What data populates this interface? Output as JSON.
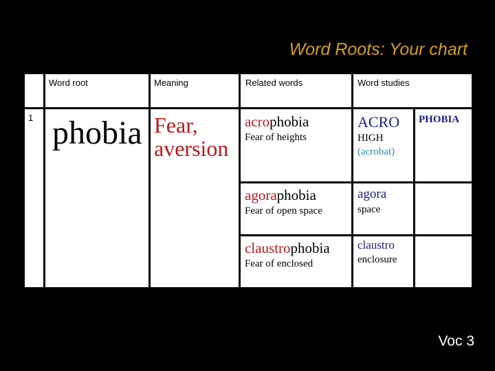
{
  "slide": {
    "title": "Word Roots: Your chart",
    "footer": "Voc 3"
  },
  "colors": {
    "title": "#d4a017",
    "background": "#000000",
    "root_highlight": "#c0161c",
    "study_root": "#1c1c8c",
    "example": "#2a8fa8"
  },
  "table": {
    "headers": {
      "number": "",
      "word_root": "Word root",
      "meaning": "Meaning",
      "related_words": "Related words",
      "word_studies": "Word studies"
    },
    "rows": [
      {
        "number": "1",
        "word_root": "phobia",
        "meaning_line1": "Fear,",
        "meaning_line2": "aversion",
        "related": [
          {
            "prefix": "acro",
            "suffix": "phobia",
            "definition": "Fear of heights",
            "study_root": "ACRO",
            "study_meaning": "HIGH",
            "study_example": "(acrobat)",
            "study_extra": "PHOBIA"
          },
          {
            "prefix": "agora",
            "suffix": "phobia",
            "definition": "Fear of open space",
            "study_root": "agora",
            "study_meaning": "space",
            "study_example": "",
            "study_extra": ""
          },
          {
            "prefix": "claustro",
            "suffix": "phobia",
            "definition": "Fear of enclosed",
            "study_root": "claustro",
            "study_meaning": "enclosure",
            "study_example": "",
            "study_extra": ""
          }
        ]
      }
    ]
  }
}
